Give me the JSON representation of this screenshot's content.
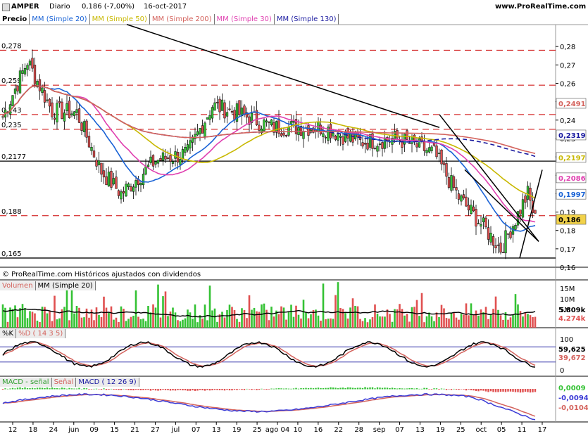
{
  "header": {
    "symbol": "AMPER",
    "period": "Diario",
    "quote": "0,186 (-7,00%)",
    "date": "16-oct-2017",
    "site": "www.ProRealTime.com"
  },
  "legend": {
    "price": "Precio",
    "sma20": "MM (Simple 20)",
    "sma50": "MM (Simple 50)",
    "sma200": "MM (Simple 200)",
    "sma30": "MM (Simple 30)",
    "sma130": "MM (Simple 130)"
  },
  "colors": {
    "up": "#34c234",
    "down": "#e05050",
    "sma20": "#1a63d6",
    "sma50": "#c8b800",
    "sma200": "#d4635d",
    "sma30": "#e040b0",
    "sma130": "#1a1aa0",
    "refline": "#cc0000",
    "stoch_k": "#000000",
    "stoch_d": "#d4635d",
    "macd": "#3a3ad6",
    "signal": "#d4635d"
  },
  "copyright": "© ProRealTime.com  Históricos ajustados con dividendos",
  "chart_data": [
    {
      "type": "candlestick",
      "title": "AMPER Diario",
      "ylim": [
        0.16,
        0.29
      ],
      "y_ticks": [
        "0,28",
        "0,27",
        "0,26",
        "0,25",
        "0,24",
        "0,23",
        "0,22",
        "0,21",
        "0,2",
        "0,19",
        "0,18",
        "0,17",
        "0,16"
      ],
      "x_ticks": [
        "12",
        "18",
        "24",
        "jun",
        "09",
        "15",
        "21",
        "27",
        "jul",
        "07",
        "13",
        "19",
        "25",
        "ago 04",
        "10",
        "16",
        "22",
        "28",
        "sep",
        "07",
        "13",
        "19",
        "25",
        "oct",
        "05",
        "11",
        "17"
      ],
      "level_labels": [
        "0,278",
        "0,259",
        "0,243",
        "0,235",
        "0,2177",
        "0,188",
        "0,165"
      ],
      "levels": [
        0.278,
        0.259,
        0.243,
        0.235,
        0.2177,
        0.188,
        0.165
      ],
      "series_last_values": [
        {
          "name": "MM (Simple 200)",
          "value": "0,2491"
        },
        {
          "name": "MM (Simple 130)",
          "value": "0,2319"
        },
        {
          "name": "MM (Simple 50)",
          "value": "0,2197"
        },
        {
          "name": "MM (Simple 30)",
          "value": "0,2086"
        },
        {
          "name": "MM (Simple 20)",
          "value": "0,1997"
        },
        {
          "name": "Precio",
          "value": "0,186"
        }
      ]
    },
    {
      "type": "bar",
      "title": "Volumen",
      "series_names": [
        "Volumen",
        "MM (Simple 20)"
      ],
      "y_ticks": [
        "15M",
        "10M",
        "5M"
      ],
      "last_values": [
        "5.809k",
        "4.274k"
      ]
    },
    {
      "type": "line",
      "title": "Stochastic",
      "series_names": [
        "%K",
        "%D ( 14 3 5)"
      ],
      "y_ticks": [
        "100",
        "0"
      ],
      "last_values": [
        "59,625",
        "39,672"
      ]
    },
    {
      "type": "line",
      "title": "MACD",
      "series_names": [
        "MACD - señal",
        "Señal",
        "MACD ( 12 26 9)"
      ],
      "last_values": [
        "0,0009",
        "-0,0094",
        "-0,0104"
      ]
    }
  ]
}
